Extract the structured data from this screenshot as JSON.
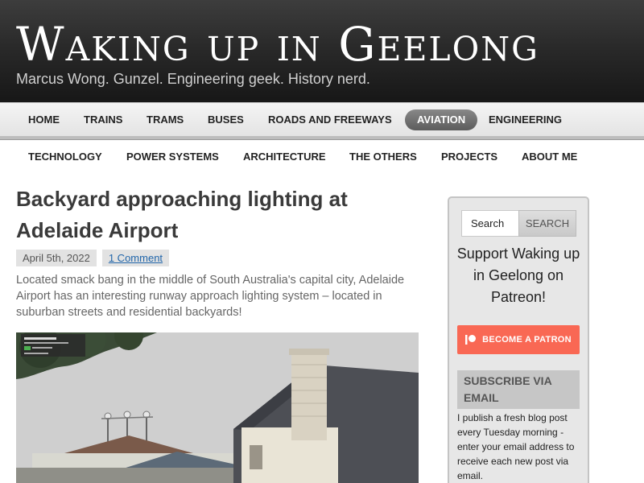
{
  "site": {
    "title": "Waking up in Geelong",
    "tagline": "Marcus Wong. Gunzel. Engineering geek. History nerd."
  },
  "nav": {
    "row1": [
      {
        "label": "Home"
      },
      {
        "label": "Trains"
      },
      {
        "label": "Trams"
      },
      {
        "label": "Buses"
      },
      {
        "label": "Roads and Freeways"
      },
      {
        "label": "Aviation",
        "active": true
      },
      {
        "label": "Engineering"
      }
    ],
    "row2": [
      {
        "label": "Technology"
      },
      {
        "label": "Power Systems"
      },
      {
        "label": "Architecture"
      },
      {
        "label": "The Others"
      },
      {
        "label": "Projects"
      },
      {
        "label": "About Me"
      }
    ]
  },
  "post": {
    "title": "Backyard approaching lighting at Adelaide Airport",
    "date": "April 5th, 2022",
    "comments": "1 Comment",
    "excerpt": "Located smack bang in the middle of South Australia's capital city, Adelaide Airport has an interesting runway approach lighting system – located in suburban streets and residential backyards!",
    "image_icon": "street-view-photo-icon"
  },
  "sidebar": {
    "search_value": "Search",
    "search_button": "Search",
    "patreon_text": "Support Waking up in Geelong on Patreon!",
    "patreon_button": "BECOME A PATRON",
    "subscribe_heading": "Subscribe via Email",
    "subscribe_text": "I publish a fresh blog post every Tuesday morning - enter your email address to receive each new post via email."
  },
  "colors": {
    "header_bg": "#2a2a2a",
    "nav_active": "#6e6e6e",
    "patreon": "#f96854",
    "link": "#2266aa"
  }
}
